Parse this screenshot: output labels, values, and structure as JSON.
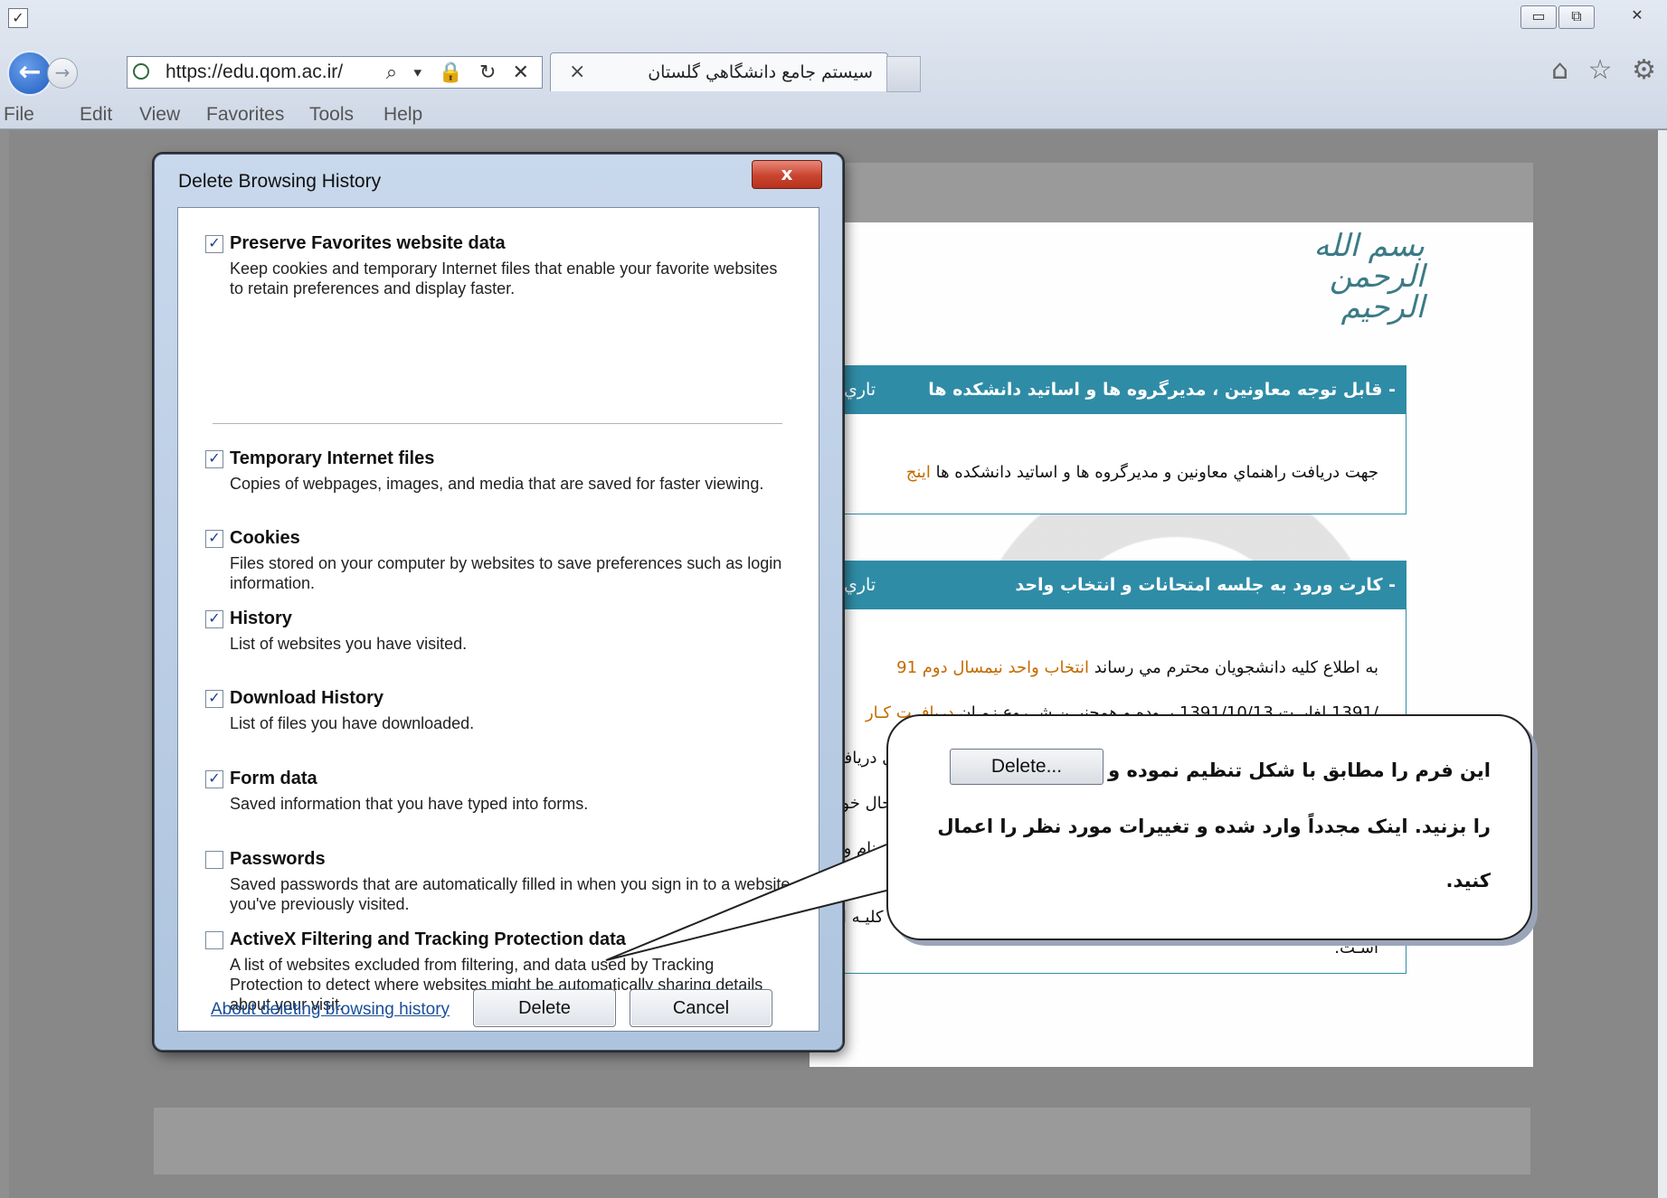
{
  "browser": {
    "url": "https://edu.qom.ac.ir/",
    "address_tools": "⌕ ▾ 🔒 ↻ ✕",
    "tab_title": "سيستم جامع دانشگاهي گلستان",
    "tab_close": "×",
    "window_buttons": {
      "minimize": "▭",
      "restore": "⧉",
      "close": "✕"
    },
    "right_icons": "⌂ ☆ ⚙",
    "menu": [
      "File",
      "Edit",
      "View",
      "Favorites",
      "Tools",
      "Help"
    ]
  },
  "site": {
    "calligraphy": "بسم الله الرحمن الرحيم",
    "news": [
      {
        "title": "- قابل توجه معاونين ، مديرگروه ها و اساتيد دانشكده ها",
        "date_label": "تاري",
        "body": "جهت دريافت راهنماي معاونين و مديرگروه ها و اساتيد دانشكده ها",
        "link": "اينج"
      },
      {
        "title": "- كارت ورود به جلسه امتحانات و انتخاب واحد",
        "date_label": "تاري",
        "line1_text": "به اطلاع كليه دانشجويان محترم مي رساند",
        "line1_link": "انتخاب واحد نيمسال دوم 91",
        "line2_text": "/1391 لغايــت 1391/10/13 بــوده و همچنيــن شــروع زمـان",
        "line2_link": "دريافــت كـار",
        "line3": "اي دريافت",
        "line4": "حال خواه",
        "line5": "نام واح",
        "line6": "كليـه امـ",
        "line7": "اسـت."
      }
    ]
  },
  "dialog": {
    "title": "Delete Browsing History",
    "close_label": "x",
    "options": [
      {
        "label": "Preserve Favorites website data",
        "desc": "Keep cookies and temporary Internet files that enable your favorite websites to retain preferences and display faster.",
        "checked": true
      },
      {
        "label": "Temporary Internet files",
        "desc": "Copies of webpages, images, and media that are saved for faster viewing.",
        "checked": true
      },
      {
        "label": "Cookies",
        "desc": "Files stored on your computer by websites to save preferences such as login information.",
        "checked": true
      },
      {
        "label": "History",
        "desc": "List of websites you have visited.",
        "checked": true
      },
      {
        "label": "Download History",
        "desc": "List of files you have downloaded.",
        "checked": true
      },
      {
        "label": "Form data",
        "desc": "Saved information that you have typed into forms.",
        "checked": true
      },
      {
        "label": "Passwords",
        "desc": "Saved passwords that are automatically filled in when you sign in to a website you've previously visited.",
        "checked": false
      },
      {
        "label": "ActiveX Filtering and Tracking Protection data",
        "desc": "A list of websites excluded from filtering, and data used by Tracking Protection to detect where websites might be automatically sharing details about your visit.",
        "checked": false
      }
    ],
    "about_link": "About deleting browsing history",
    "delete_label": "Delete",
    "cancel_label": "Cancel"
  },
  "callout": {
    "line1": "اين فرم را مطابق با شكل تنظيم نموده و دكمه",
    "button_label": "Delete...",
    "line2": "را بزنيد. اينک مجدداً وارد شده و تغييرات مورد نظر را اعمال",
    "line3": "كنيد."
  }
}
